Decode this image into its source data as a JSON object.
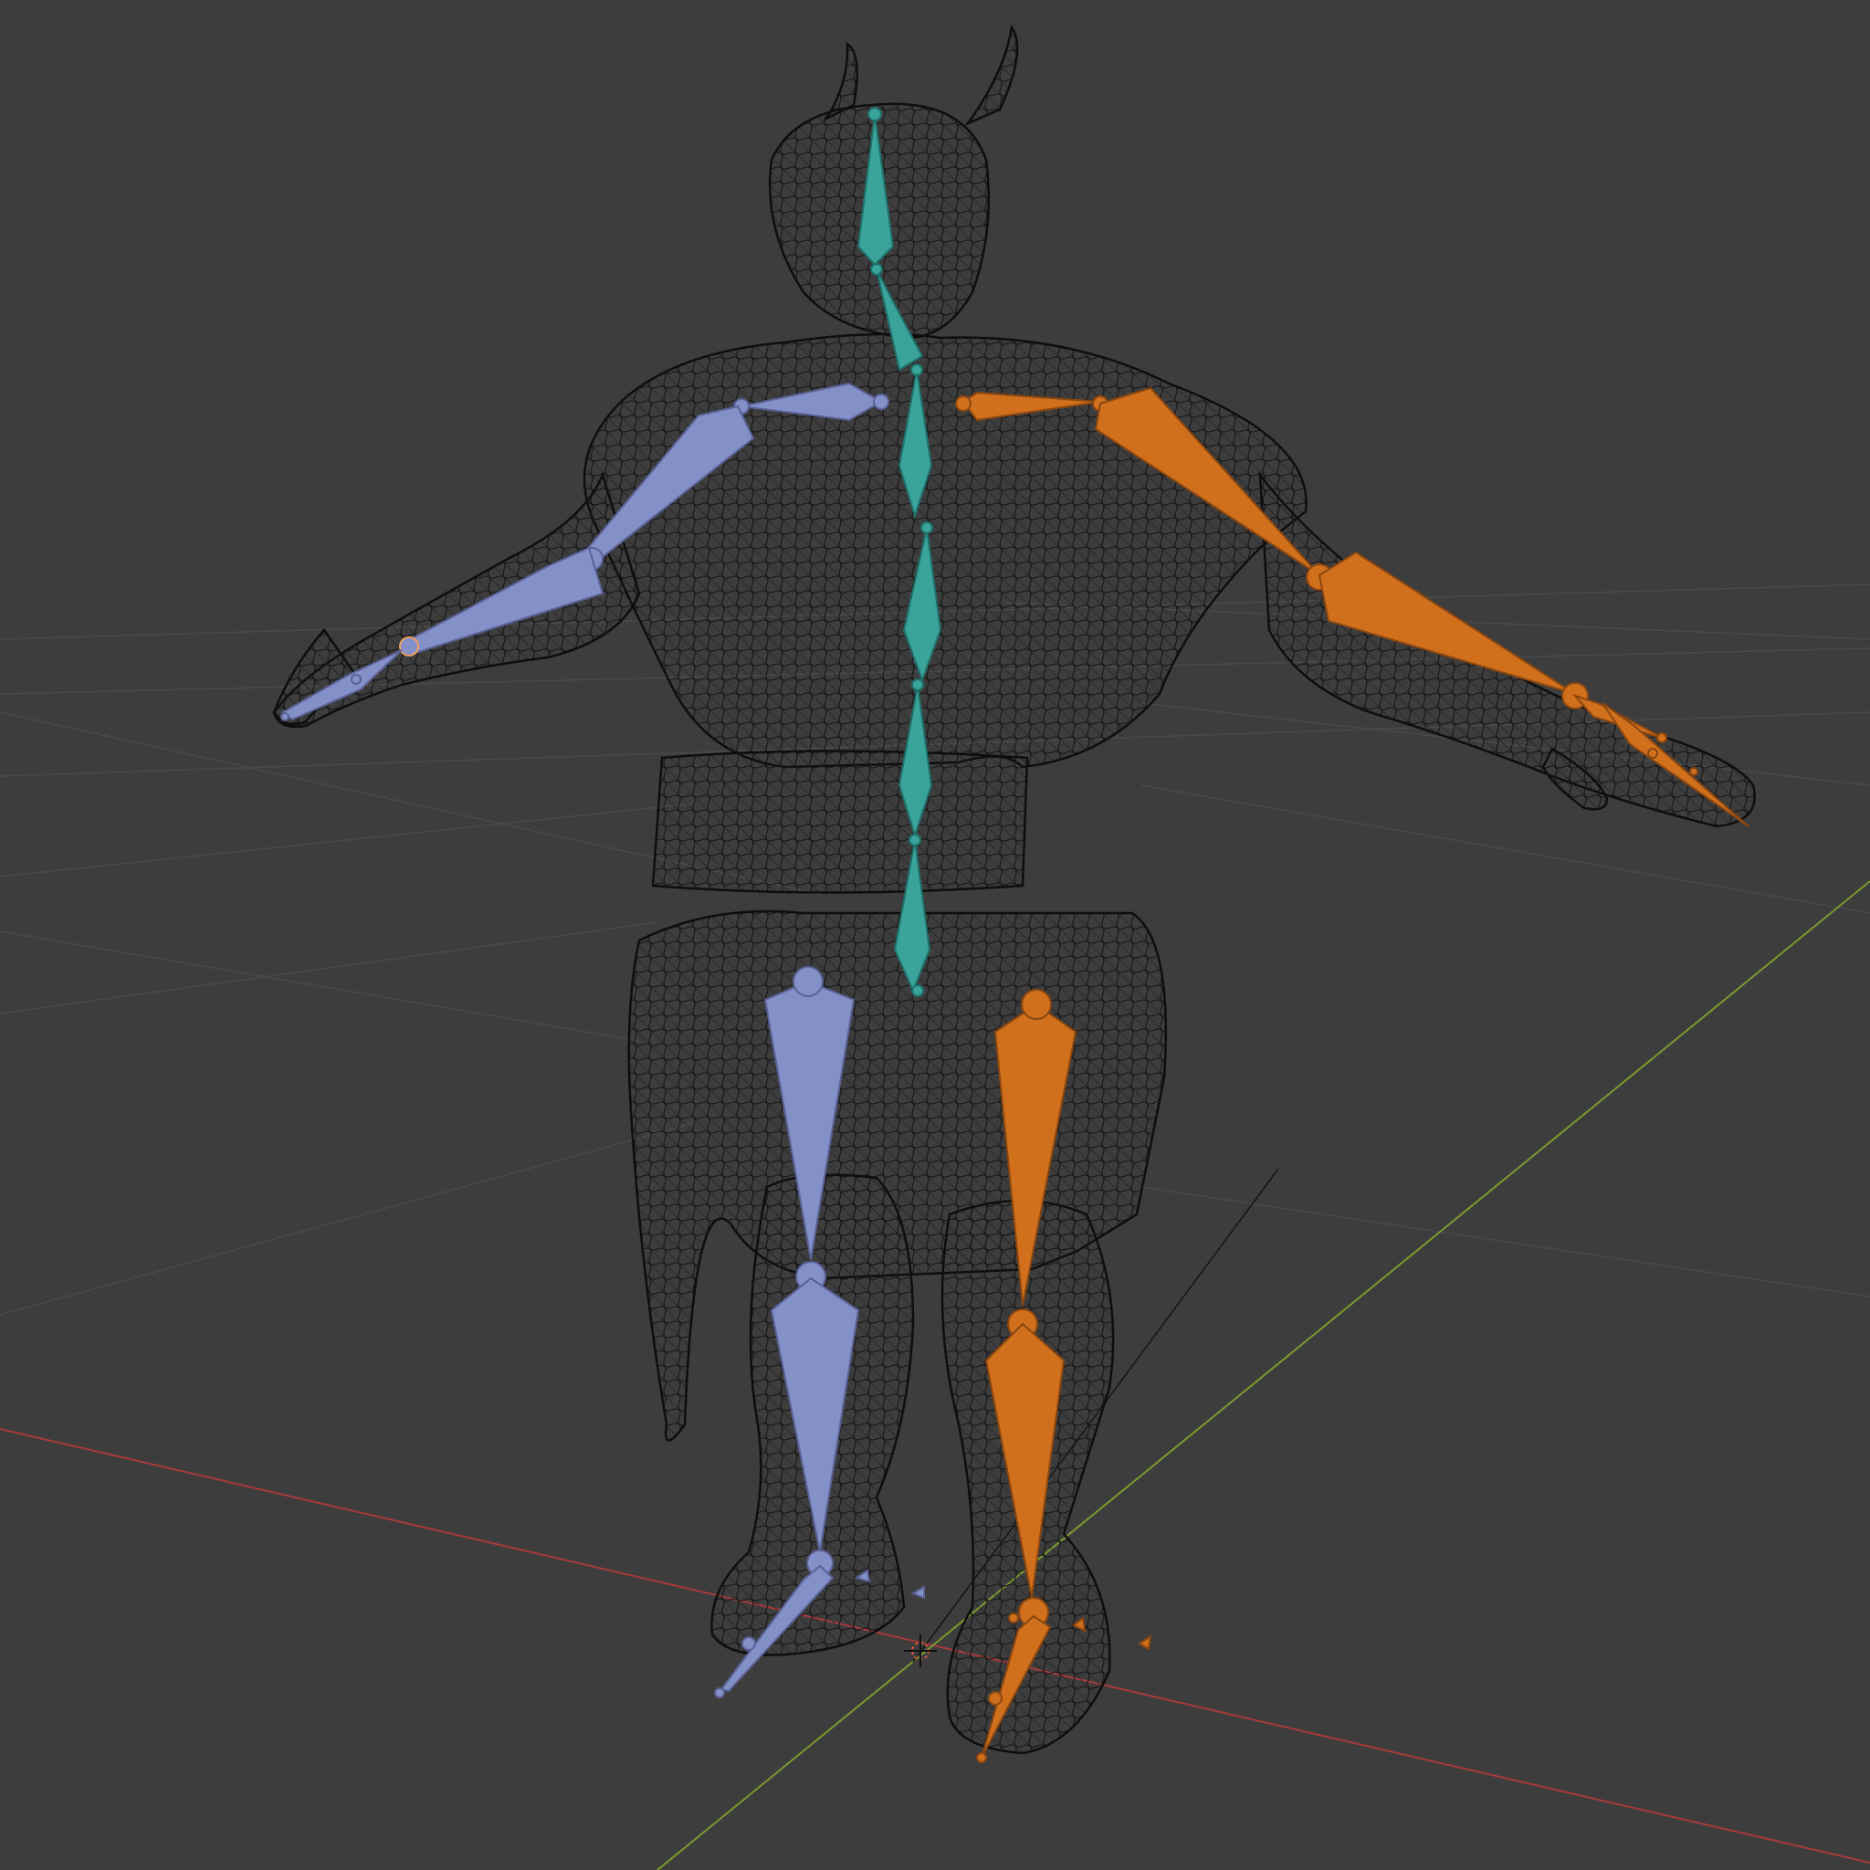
{
  "viewport": {
    "background": "#3d3d3d",
    "grid_color": "#4a4a4a",
    "x_axis_color": "#a83a3a",
    "y_axis_color": "#7a9a2e",
    "wire_color": "#111111",
    "bone_colors": {
      "spine": "#3aa39a",
      "left_limbs": "#8490c8",
      "right_limbs": "#d0701c",
      "active_outline": "#f0a060"
    },
    "icons": [
      "3d-cursor-icon"
    ]
  }
}
